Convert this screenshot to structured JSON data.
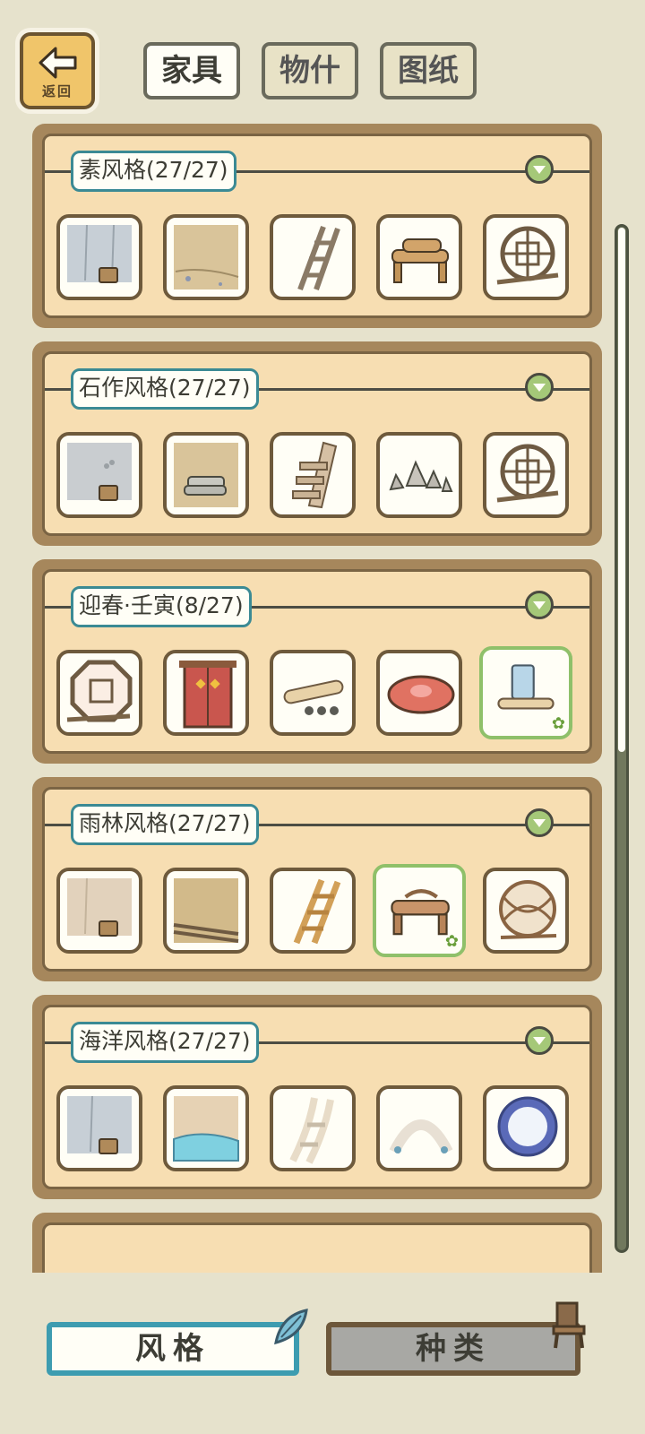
{
  "header": {
    "back_label": "返回",
    "tabs": [
      {
        "label": "家具",
        "active": true
      },
      {
        "label": "物什",
        "active": false
      },
      {
        "label": "图纸",
        "active": false
      }
    ]
  },
  "categories": [
    {
      "title": "素风格(27/27)",
      "items": [
        "wall-bucket",
        "floor-dirt",
        "ladder",
        "log-bench",
        "round-window"
      ],
      "selected_index": -1
    },
    {
      "title": "石作风格(27/27)",
      "items": [
        "wall-bucket",
        "floor-stone",
        "stone-stairs",
        "rock-pile",
        "round-window"
      ],
      "selected_index": -1
    },
    {
      "title": "迎春·壬寅(8/27)",
      "items": [
        "octagon-window",
        "red-door",
        "scroll-cart",
        "red-cushion",
        "cup-scroll"
      ],
      "selected_index": 4
    },
    {
      "title": "雨林风格(27/27)",
      "items": [
        "wall-bucket",
        "floor-plank",
        "wooden-ladder",
        "vine-stool",
        "wicker-ball"
      ],
      "selected_index": 3
    },
    {
      "title": "海洋风格(27/27)",
      "items": [
        "wall-bucket",
        "floor-water",
        "bone-ladder",
        "shell-arch",
        "porthole-mirror"
      ],
      "selected_index": -1
    }
  ],
  "bottom_tabs": {
    "style_label": "风格",
    "kind_label": "种类"
  },
  "colors": {
    "panel_border": "#a6875c",
    "panel_fill": "#f7deb2",
    "title_border": "#3b8a94",
    "selected_border": "#8fc06a"
  }
}
